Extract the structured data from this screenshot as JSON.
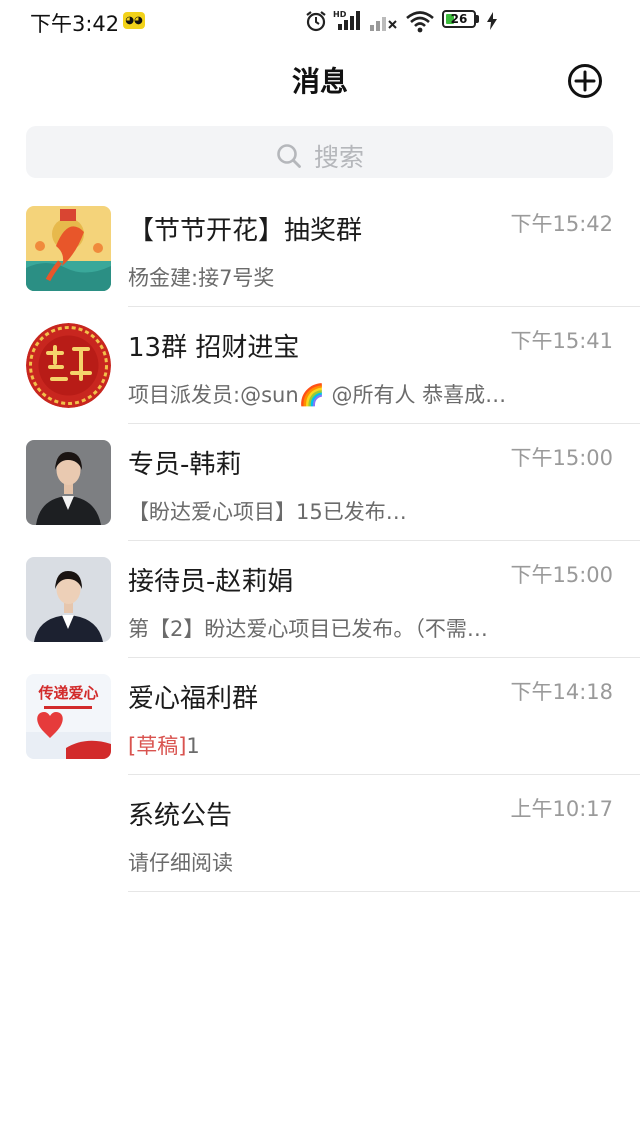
{
  "status_bar": {
    "time": "下午3:42",
    "battery": "26"
  },
  "header": {
    "title": "消息"
  },
  "search": {
    "placeholder": "搜索"
  },
  "conversations": [
    {
      "name": "【节节开花】抽奖群",
      "time": "下午15:42",
      "preview": "杨金建:接7号奖"
    },
    {
      "name": "13群 招财进宝",
      "time": "下午15:41",
      "preview": "项目派发员:@sun🌈 @所有人 恭喜成…"
    },
    {
      "name": "专员-韩莉",
      "time": "下午15:00",
      "preview": "【盼达爱心项目】15已发布…"
    },
    {
      "name": "接待员-赵莉娟",
      "time": "下午15:00",
      "preview": "第【2】盼达爱心项目已发布。（不需…"
    },
    {
      "name": "爱心福利群",
      "time": "下午14:18",
      "draft_tag": "[草稿]",
      "preview": "1"
    },
    {
      "name": "系统公告",
      "time": "上午10:17",
      "preview": "请仔细阅读"
    }
  ],
  "avatars": {
    "item4_text": "传递爱心"
  },
  "colors": {
    "accent_draft": "#d9534f",
    "battery_fill": "#3dbb3d"
  }
}
